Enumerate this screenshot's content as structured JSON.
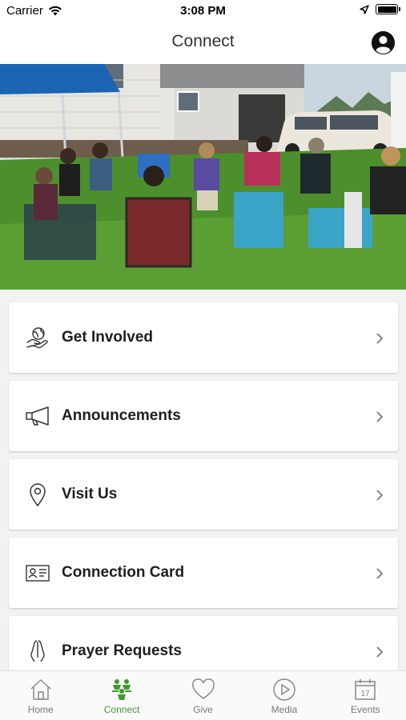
{
  "status_bar": {
    "carrier": "Carrier",
    "time": "3:08 PM"
  },
  "nav": {
    "title": "Connect"
  },
  "hero": {
    "alt": "Group of people seated in camp chairs in a circle on a lawn"
  },
  "menu": [
    {
      "label": "Get Involved",
      "icon": "hand-globe-icon"
    },
    {
      "label": "Announcements",
      "icon": "megaphone-icon"
    },
    {
      "label": "Visit Us",
      "icon": "location-pin-icon"
    },
    {
      "label": "Connection Card",
      "icon": "id-card-icon"
    },
    {
      "label": "Prayer Requests",
      "icon": "praying-hands-icon"
    }
  ],
  "tabs": [
    {
      "label": "Home",
      "icon": "home-icon",
      "active": false
    },
    {
      "label": "Connect",
      "icon": "people-icon",
      "active": true
    },
    {
      "label": "Give",
      "icon": "heart-icon",
      "active": false
    },
    {
      "label": "Media",
      "icon": "play-icon",
      "active": false
    },
    {
      "label": "Events",
      "icon": "calendar-icon",
      "active": false
    }
  ],
  "colors": {
    "accent": "#3d9b2c",
    "text": "#1e1e1e",
    "tab_inactive": "#777777"
  }
}
